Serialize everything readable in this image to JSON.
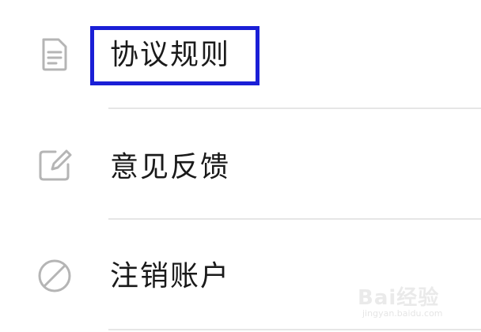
{
  "menu": {
    "items": [
      {
        "label": "协议规则",
        "icon": "document-icon"
      },
      {
        "label": "意见反馈",
        "icon": "edit-icon"
      },
      {
        "label": "注销账户",
        "icon": "prohibited-icon"
      }
    ]
  },
  "watermark": {
    "main": "Bai经验",
    "sub": "jingyan.baidu.com"
  },
  "colors": {
    "highlight": "#1a1fd6",
    "icon": "#b5b5b5",
    "text": "#1a1a1a",
    "divider": "#e6e6e6"
  }
}
